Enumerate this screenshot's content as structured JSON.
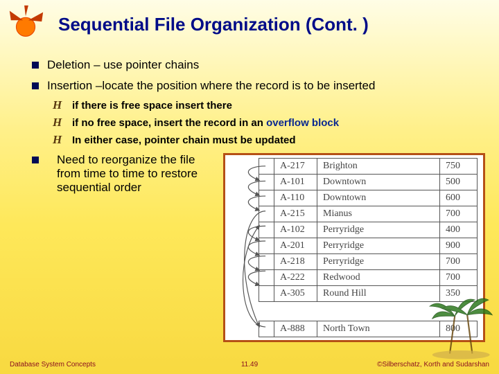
{
  "title": "Sequential File Organization (Cont. )",
  "bullets": {
    "deletion": "Deletion – use pointer chains",
    "insertion": "Insertion –locate the position where the record is to be inserted",
    "sub1": "if there is free space insert there",
    "sub2_a": "if no free space, insert the record in an ",
    "sub2_term": "overflow block",
    "sub3": "In either case, pointer chain must be updated",
    "reorganize": "Need to reorganize the file from time to time to restore sequential order"
  },
  "records": [
    {
      "code": "A-217",
      "city": "Brighton",
      "num": "750"
    },
    {
      "code": "A-101",
      "city": "Downtown",
      "num": "500"
    },
    {
      "code": "A-110",
      "city": "Downtown",
      "num": "600"
    },
    {
      "code": "A-215",
      "city": "Mianus",
      "num": "700"
    },
    {
      "code": "A-102",
      "city": "Perryridge",
      "num": "400"
    },
    {
      "code": "A-201",
      "city": "Perryridge",
      "num": "900"
    },
    {
      "code": "A-218",
      "city": "Perryridge",
      "num": "700"
    },
    {
      "code": "A-222",
      "city": "Redwood",
      "num": "700"
    },
    {
      "code": "A-305",
      "city": "Round Hill",
      "num": "350"
    }
  ],
  "overflow_record": {
    "code": "A-888",
    "city": "North Town",
    "num": "800"
  },
  "footer": {
    "left": "Database System Concepts",
    "mid": "11.49",
    "right": "©Silberschatz, Korth and Sudarshan"
  },
  "icons": {
    "sun": "sun-icon",
    "script_h": "H",
    "palm": "palm-icon"
  }
}
